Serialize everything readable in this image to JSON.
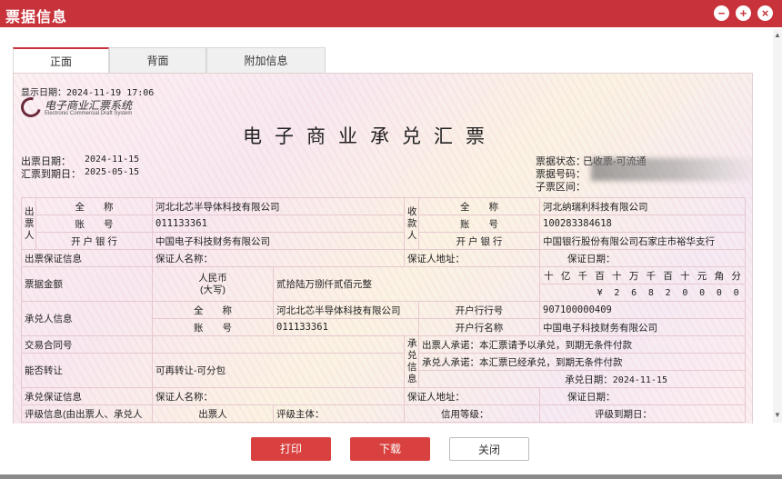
{
  "window": {
    "title": "票据信息",
    "min_glyph": "−",
    "max_glyph": "+",
    "close_glyph": "×",
    "accent": "#c8323a"
  },
  "tabs": [
    {
      "label": "正面",
      "active": true
    },
    {
      "label": "背面",
      "active": false
    },
    {
      "label": "附加信息",
      "active": false
    }
  ],
  "header": {
    "display_date": "显示日期：2024-11-19 17:06",
    "logo_cn": "电子商业汇票系统",
    "logo_en": "Electronic Commercial Draft System",
    "title": "电子商业承兑汇票",
    "issue_date_label": "出票日期：",
    "issue_date": "2024-11-15",
    "due_date_label": "汇票到期日：",
    "due_date": "2025-05-15",
    "status_label": "票据状态：",
    "status": "已收票-可流通",
    "bill_no_label": "票据号码：",
    "sub_range_label": "子票区间："
  },
  "drawer": {
    "side_label": "出票人",
    "name_label": "全　　称",
    "name": "河北北芯半导体科技有限公司",
    "account_label": "账　　号",
    "account": "011133361",
    "bank_label": "开 户 银 行",
    "bank": "中国电子科技财务有限公司"
  },
  "payee": {
    "side_label": "收款人",
    "name_label": "全　　称",
    "name": "河北纳瑞利科技有限公司",
    "account_label": "账　　号",
    "account": "100283384618",
    "bank_label": "开 户 银 行",
    "bank": "中国银行股份有限公司石家庄市裕华支行"
  },
  "drawer_guarantee": {
    "label": "出票保证信息",
    "name_label": "保证人名称：",
    "addr_label": "保证人地址：",
    "date_label": "保证日期："
  },
  "amount": {
    "label": "票据金额",
    "currency_label": "人民币",
    "currency_sub": "(大写)",
    "in_words": "贰拾陆万捌仟贰佰元整",
    "unit_headers": [
      "十",
      "亿",
      "千",
      "百",
      "十",
      "万",
      "千",
      "百",
      "十",
      "元",
      "角",
      "分"
    ],
    "digits": [
      "",
      "",
      "",
      "¥",
      "2",
      "6",
      "8",
      "2",
      "0",
      "0",
      "0",
      "0"
    ]
  },
  "acceptor": {
    "label": "承兑人信息",
    "name_label": "全　　称",
    "name": "河北北芯半导体科技有限公司",
    "account_label": "账　　号",
    "account": "011133361",
    "bank_no_label": "开户行行号",
    "bank_no": "907100000409",
    "bank_name_label": "开户行名称",
    "bank_name": "中国电子科技财务有限公司"
  },
  "contract": {
    "label": "交易合同号"
  },
  "transfer": {
    "label": "能否转让",
    "value": "可再转让-可分包"
  },
  "acceptance_info": {
    "side_label": "承兑信息",
    "drawer_promise_label": "出票人承诺：",
    "drawer_promise": "本汇票请予以承兑，到期无条件付款",
    "acceptor_promise_label": "承兑人承诺：",
    "acceptor_promise": "本汇票已经承兑，到期无条件付款",
    "accept_date_label": "承兑日期：",
    "accept_date": "2024-11-15"
  },
  "acceptance_guarantee": {
    "label": "承兑保证信息",
    "name_label": "保证人名称：",
    "addr_label": "保证人地址：",
    "date_label": "保证日期："
  },
  "rating": {
    "label": "评级信息(由出票人、承兑人",
    "drawer_label": "出票人",
    "subject_label": "评级主体：",
    "grade_label": "信用等级：",
    "expiry_label": "评级到期日："
  },
  "buttons": {
    "print": "打印",
    "download": "下载",
    "close": "关闭"
  }
}
